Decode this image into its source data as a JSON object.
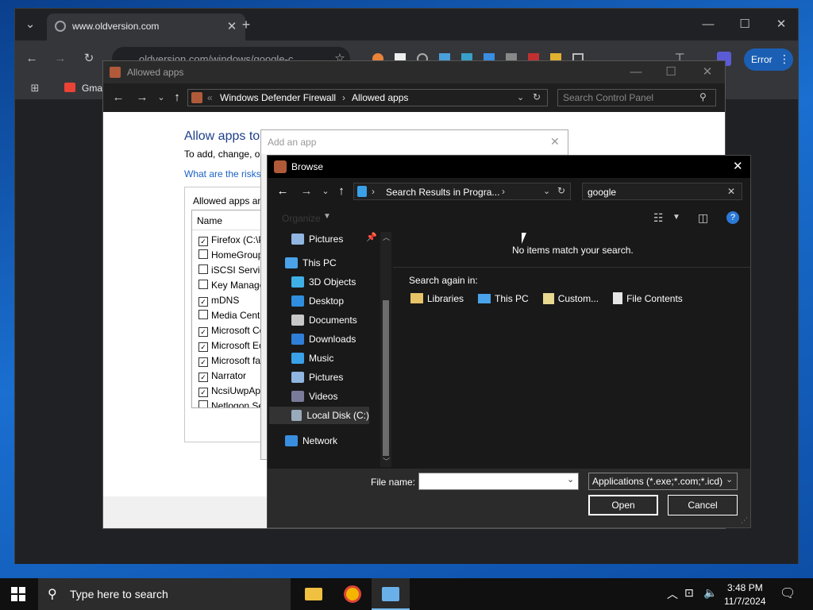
{
  "browser": {
    "tab_title": "www.oldversion.com",
    "url": "oldversion.com/windows/google-c",
    "error_label": "Error",
    "bookmark_gmail": "Gma"
  },
  "allowed_apps": {
    "window_title": "Allowed apps",
    "breadcrumb": [
      "Windows Defender Firewall",
      "Allowed apps"
    ],
    "search_placeholder": "Search Control Panel",
    "heading": "Allow apps to",
    "subtext": "To add, change, or",
    "risk_link": "What are the risks",
    "group_label": "Allowed apps an",
    "column_name": "Name",
    "apps": [
      {
        "name": "Firefox (C:\\P",
        "checked": true
      },
      {
        "name": "HomeGroup",
        "checked": false
      },
      {
        "name": "iSCSI Service",
        "checked": false
      },
      {
        "name": "Key Manage",
        "checked": false
      },
      {
        "name": "mDNS",
        "checked": true
      },
      {
        "name": "Media Cente",
        "checked": false
      },
      {
        "name": "Microsoft Co",
        "checked": true
      },
      {
        "name": "Microsoft Ec",
        "checked": true
      },
      {
        "name": "Microsoft fa",
        "checked": true
      },
      {
        "name": "Narrator",
        "checked": true
      },
      {
        "name": "NcsiUwpApp",
        "checked": true
      },
      {
        "name": "Netlogon Se",
        "checked": false
      }
    ]
  },
  "add_app": {
    "title": "Add an app"
  },
  "browse": {
    "title": "Browse",
    "path": "Search Results in Progra...",
    "search_value": "google",
    "organize_label": "Organize",
    "nav": [
      {
        "label": "Pictures",
        "icon": "pictures-icon",
        "color": "#8fb5e0"
      },
      {
        "label": "This PC",
        "icon": "this-pc-icon",
        "color": "#4aa3e8"
      },
      {
        "label": "3D Objects",
        "icon": "3d-objects-icon",
        "color": "#3fb0e6"
      },
      {
        "label": "Desktop",
        "icon": "desktop-icon",
        "color": "#2f8ee0"
      },
      {
        "label": "Documents",
        "icon": "documents-icon",
        "color": "#c8c8c8"
      },
      {
        "label": "Downloads",
        "icon": "downloads-icon",
        "color": "#2f7fd8"
      },
      {
        "label": "Music",
        "icon": "music-icon",
        "color": "#3aa0e8"
      },
      {
        "label": "Pictures",
        "icon": "pictures-icon",
        "color": "#8fb5e0"
      },
      {
        "label": "Videos",
        "icon": "videos-icon",
        "color": "#7a7a9a"
      },
      {
        "label": "Local Disk (C:)",
        "icon": "local-disk-icon",
        "color": "#9ab"
      },
      {
        "label": "Network",
        "icon": "network-icon",
        "color": "#3a8ee0"
      }
    ],
    "no_items": "No items match your search.",
    "search_again": "Search again in:",
    "search_locations": [
      "Libraries",
      "This PC",
      "Custom...",
      "File Contents"
    ],
    "file_name_label": "File name:",
    "file_name_value": "",
    "file_type": "Applications (*.exe;*.com;*.icd)",
    "open_label": "Open",
    "cancel_label": "Cancel"
  },
  "taskbar": {
    "search_placeholder": "Type here to search",
    "time": "3:48 PM",
    "date": "11/7/2024"
  }
}
